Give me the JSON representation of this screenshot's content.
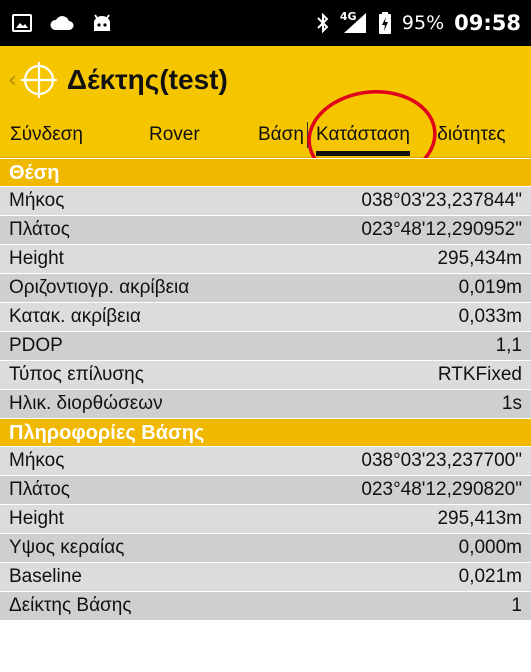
{
  "status_bar": {
    "network_label": "4G",
    "battery_percent": "95%",
    "time": "09:58",
    "icons": [
      "image-icon",
      "cloud-icon",
      "android-icon",
      "bluetooth-icon",
      "signal-icon",
      "battery-charging-icon"
    ]
  },
  "app_bar": {
    "title": "Δέκτης(test)",
    "back_glyph": "‹"
  },
  "tabs": [
    {
      "label": "Σύνδεση"
    },
    {
      "label": "Rover"
    },
    {
      "label": "Βάση"
    },
    {
      "label": "Κατάσταση",
      "active": true
    },
    {
      "label": "Ιδιότητες"
    }
  ],
  "sections": [
    {
      "title": "Θέση",
      "rows": [
        {
          "label": "Μήκος",
          "value": "038°03'23,237844\""
        },
        {
          "label": "Πλάτος",
          "value": "023°48'12,290952\""
        },
        {
          "label": "Height",
          "value": "295,434m"
        },
        {
          "label": "Οριζοντιογρ. ακρίβεια",
          "value": "0,019m"
        },
        {
          "label": "Κατακ. ακρίβεια",
          "value": "0,033m"
        },
        {
          "label": "PDOP",
          "value": "1,1"
        },
        {
          "label": "Τύπος επίλυσης",
          "value": "RTKFixed"
        },
        {
          "label": "Ηλικ. διορθώσεων",
          "value": "1s"
        }
      ]
    },
    {
      "title": "Πληροφορίες Βάσης",
      "rows": [
        {
          "label": "Μήκος",
          "value": "038°03'23,237700\""
        },
        {
          "label": "Πλάτος",
          "value": "023°48'12,290820\""
        },
        {
          "label": "Height",
          "value": "295,413m"
        },
        {
          "label": "Υψος κεραίας",
          "value": "0,000m"
        },
        {
          "label": "Baseline",
          "value": "0,021m"
        },
        {
          "label": "Δείκτης Βάσης",
          "value": "1"
        }
      ]
    }
  ],
  "colors": {
    "accent": "#f5c600",
    "section_header": "#f0b800",
    "row_light": "#dcdcdc",
    "row_dark": "#cfcfcf",
    "annotation": "#e0001b"
  }
}
